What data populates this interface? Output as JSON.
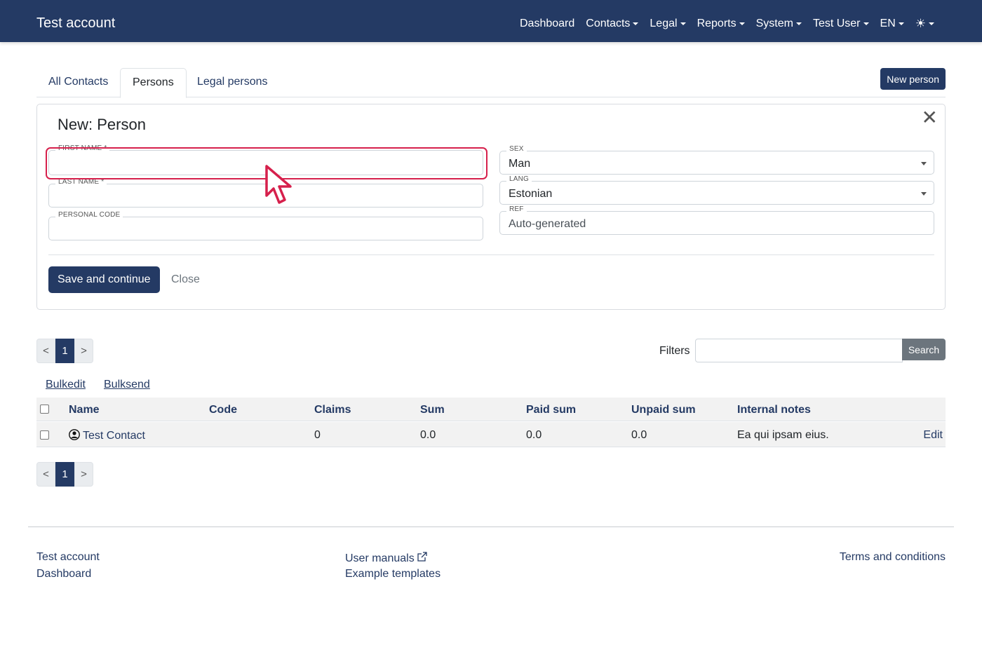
{
  "navbar": {
    "brand": "Test account",
    "items": [
      {
        "label": "Dashboard",
        "dropdown": false
      },
      {
        "label": "Contacts",
        "dropdown": true
      },
      {
        "label": "Legal",
        "dropdown": true
      },
      {
        "label": "Reports",
        "dropdown": true
      },
      {
        "label": "System",
        "dropdown": true
      },
      {
        "label": "Test User",
        "dropdown": true
      },
      {
        "label": "EN",
        "dropdown": true
      }
    ],
    "theme_icon": "☀"
  },
  "tabs": [
    {
      "label": "All Contacts",
      "active": false
    },
    {
      "label": "Persons",
      "active": true
    },
    {
      "label": "Legal persons",
      "active": false
    }
  ],
  "new_person_button": "New person",
  "form": {
    "title": "New: Person",
    "first_name": {
      "label": "FIRST NAME *",
      "value": ""
    },
    "last_name": {
      "label": "LAST NAME *",
      "value": ""
    },
    "personal_code": {
      "label": "PERSONAL CODE",
      "value": ""
    },
    "sex": {
      "label": "SEX",
      "value": "Man"
    },
    "lang": {
      "label": "LANG",
      "value": "Estonian"
    },
    "ref": {
      "label": "REF",
      "placeholder": "Auto-generated"
    },
    "save_button": "Save and continue",
    "close_link": "Close"
  },
  "pagination": {
    "prev": "<",
    "current": "1",
    "next": ">"
  },
  "filters": {
    "label": "Filters",
    "value": "",
    "search_button": "Search"
  },
  "bulk_actions": {
    "bulkedit": "Bulkedit",
    "bulksend": "Bulksend"
  },
  "table": {
    "columns": [
      "Name",
      "Code",
      "Claims",
      "Sum",
      "Paid sum",
      "Unpaid sum",
      "Internal notes"
    ],
    "rows": [
      {
        "name": "Test Contact",
        "code": "",
        "claims": "0",
        "sum": "0.0",
        "paid_sum": "0.0",
        "unpaid_sum": "0.0",
        "notes": "Ea qui ipsam eius.",
        "action": "Edit"
      }
    ]
  },
  "footer": {
    "col1": [
      "Test account",
      "Dashboard"
    ],
    "col2": [
      "User manuals",
      "Example templates"
    ],
    "col3": [
      "Terms and conditions"
    ]
  },
  "colors": {
    "primary": "#243a64",
    "highlight": "#d6204c",
    "secondary": "#6c757d"
  }
}
